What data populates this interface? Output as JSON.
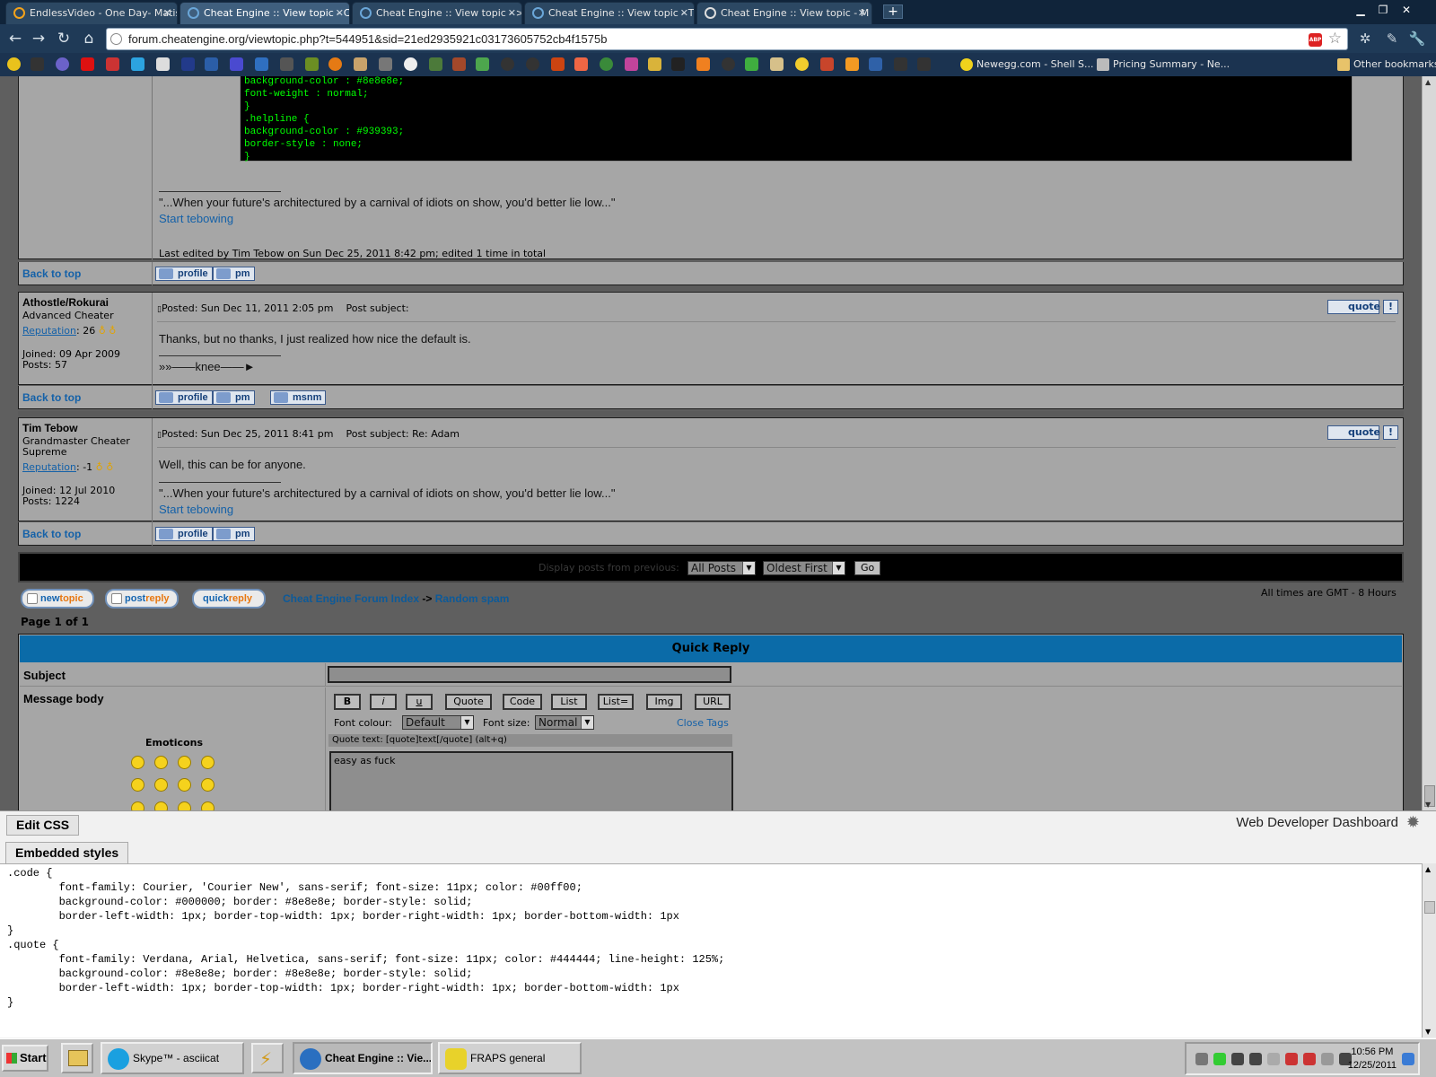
{
  "browser": {
    "tabs": [
      {
        "title": "EndlessVideo - One Day- Matis"
      },
      {
        "title": "Cheat Engine :: View topic - Cl"
      },
      {
        "title": "Cheat Engine :: View topic - >l"
      },
      {
        "title": "Cheat Engine :: View topic - Th"
      },
      {
        "title": "Cheat Engine :: View topic - M"
      }
    ],
    "url": "forum.cheatengine.org/viewtopic.php?t=544951&sid=21ed2935921c03173605752cb4f1575b",
    "bookmarks": {
      "newegg": "Newegg.com - Shell S...",
      "pricing": "Pricing Summary - Ne...",
      "other": "Other bookmarks"
    }
  },
  "post1": {
    "code_lines": [
      "background-color : #8e8e8e;",
      "font-weight : normal;",
      "}",
      ".helpline {",
      "background-color : #939393;",
      "border-style : none;",
      "}"
    ],
    "signature_quote": "\"...When your future's architectured by a carnival of idiots on show, you'd better lie low...\"",
    "signature_link": "Start tebowing",
    "edited": "Last edited by Tim Tebow on Sun Dec 25, 2011 8:42 pm; edited 1 time in total"
  },
  "common": {
    "back_to_top": "Back to top",
    "profile": "profile",
    "pm": "pm",
    "msnm": "msnm",
    "quote": "quote",
    "report": "!"
  },
  "post2": {
    "author": "Athostle/Rokurai",
    "rank": "Advanced Cheater",
    "reputation_label": "Reputation",
    "reputation_value": ": 26",
    "joined": "Joined: 09 Apr 2009",
    "posts": "Posts: 57",
    "posted": "Posted: Sun Dec 11, 2011 2:05 pm",
    "subject": "Post subject:",
    "body": "Thanks, but no thanks, I just realized how nice the default is.",
    "signature": "»»——knee——►"
  },
  "post3": {
    "author": "Tim Tebow",
    "rank_line1": "Grandmaster Cheater",
    "rank_line2": "Supreme",
    "reputation_label": "Reputation",
    "reputation_value": ": -1",
    "joined": "Joined: 12 Jul 2010",
    "posts": "Posts: 1224",
    "posted": "Posted: Sun Dec 25, 2011 8:41 pm",
    "subject": "Post subject: Re: Adam",
    "body": "Well, this can be for anyone.",
    "signature_quote": "\"...When your future's architectured by a carnival of idiots on show, you'd better lie low...\"",
    "signature_link": "Start tebowing"
  },
  "display_bar": {
    "label": "Display posts from previous:",
    "filter_value": "All Posts",
    "order_value": "Oldest First",
    "go": "Go"
  },
  "navigation": {
    "newtopic_a": "new",
    "newtopic_b": "topic",
    "postreply_a": "post",
    "postreply_b": "reply",
    "quickreply_a": "quick",
    "quickreply_b": "reply",
    "forum_index": "Cheat Engine Forum Index",
    "arrow": "->",
    "forum": "Random spam",
    "timezone": "All times are GMT - 8 Hours",
    "page": "Page 1 of 1"
  },
  "quick_reply": {
    "header": "Quick Reply",
    "subject_label": "Subject",
    "message_label": "Message body",
    "emoticons_label": "Emoticons",
    "buttons": [
      "B",
      "i",
      "u",
      "Quote",
      "Code",
      "List",
      "List=",
      "Img",
      "URL"
    ],
    "font_colour_label": "Font colour:",
    "font_colour_value": "Default",
    "font_size_label": "Font size:",
    "font_size_value": "Normal",
    "close_tags": "Close Tags",
    "helpline": "Quote text: [quote]text[/quote]  (alt+q)",
    "message_value": "easy as fuck"
  },
  "dev_panel": {
    "edit_css": "Edit CSS",
    "dashboard": "Web Developer Dashboard",
    "tab": "Embedded styles",
    "lines": [
      ".code {",
      "        font-family: Courier, 'Courier New', sans-serif; font-size: 11px; color: #00ff00;",
      "        background-color: #000000; border: #8e8e8e; border-style: solid;",
      "        border-left-width: 1px; border-top-width: 1px; border-right-width: 1px; border-bottom-width: 1px",
      "}",
      "",
      ".quote {",
      "        font-family: Verdana, Arial, Helvetica, sans-serif; font-size: 11px; color: #444444; line-height: 125%;",
      "        background-color: #8e8e8e; border: #8e8e8e; border-style: solid;",
      "        border-left-width: 1px; border-top-width: 1px; border-right-width: 1px; border-bottom-width: 1px",
      "}"
    ]
  },
  "taskbar": {
    "start": "Start",
    "skype": "Skype™ - asciicat",
    "cheatengine": "Cheat Engine :: Vie...",
    "fraps": "FRAPS general",
    "time": "10:56 PM",
    "date": "12/25/2011"
  }
}
